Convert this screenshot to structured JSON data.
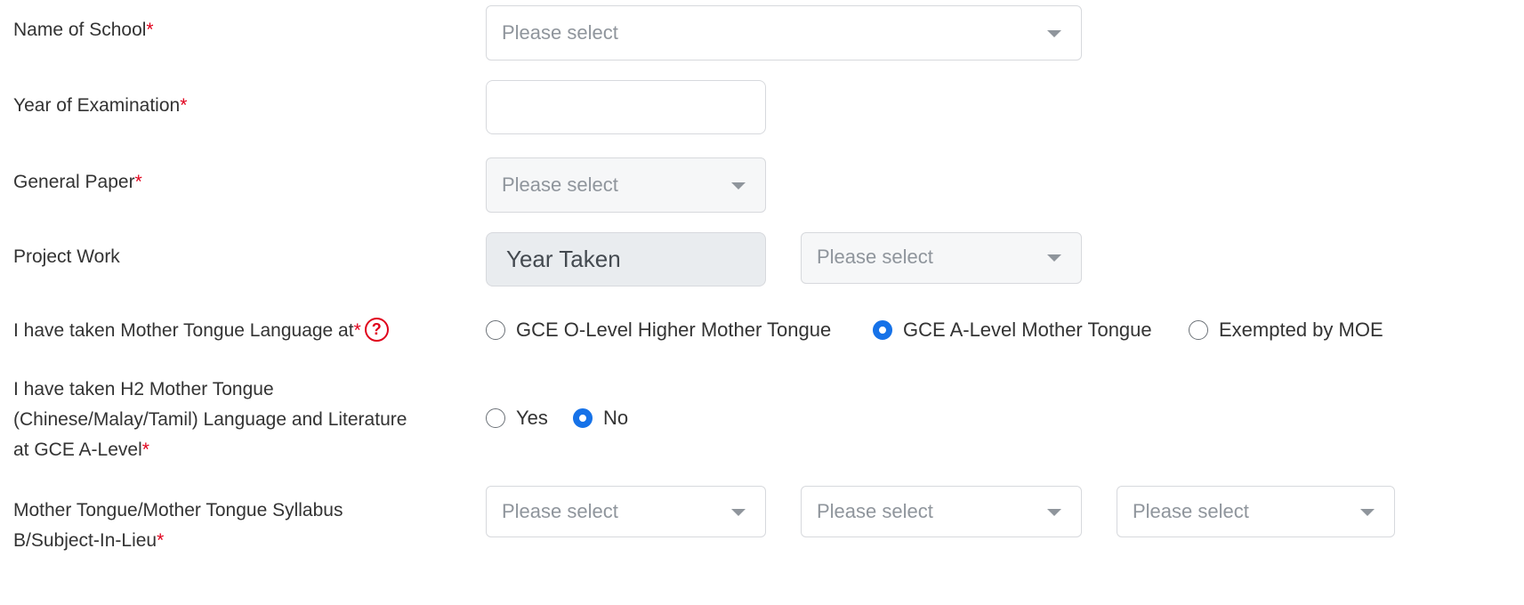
{
  "fields": {
    "school": {
      "label": "Name of School",
      "required_mark": "*",
      "placeholder": "Please select"
    },
    "exam_year": {
      "label": "Year of Examination",
      "required_mark": "*",
      "value": ""
    },
    "general_paper": {
      "label": "General Paper",
      "required_mark": "*",
      "placeholder": "Please select"
    },
    "project_work": {
      "label": "Project Work",
      "year_taken_placeholder": "Year Taken",
      "grade_placeholder": "Please select"
    },
    "mother_tongue_level": {
      "label": "I have taken Mother Tongue Language at",
      "required_mark": "*",
      "help_icon": "question-circle-icon",
      "help_glyph": "?",
      "options": [
        {
          "label": "GCE O-Level Higher Mother Tongue",
          "checked": false
        },
        {
          "label": "GCE A-Level Mother Tongue",
          "checked": true
        },
        {
          "label": "Exempted by MOE",
          "checked": false
        }
      ]
    },
    "h2_mother_tongue": {
      "label_lines": [
        "I have taken H2 Mother Tongue",
        "(Chinese/Malay/Tamil) Language and Literature",
        "at GCE A-Level"
      ],
      "required_mark": "*",
      "options": [
        {
          "label": "Yes",
          "checked": false
        },
        {
          "label": "No",
          "checked": true
        }
      ]
    },
    "mother_tongue_syllabus": {
      "label_lines": [
        "Mother Tongue/Mother Tongue Syllabus",
        "B/Subject-In-Lieu"
      ],
      "required_mark": "*",
      "selects": [
        "Please select",
        "Please select",
        "Please select"
      ]
    }
  },
  "colors": {
    "accent": "#1672e8",
    "required": "#e0001b",
    "placeholder": "#8f959c",
    "border": "#d7d9dd",
    "disabled_bg": "#f6f7f8",
    "readonly_bg": "#e9ecef"
  }
}
